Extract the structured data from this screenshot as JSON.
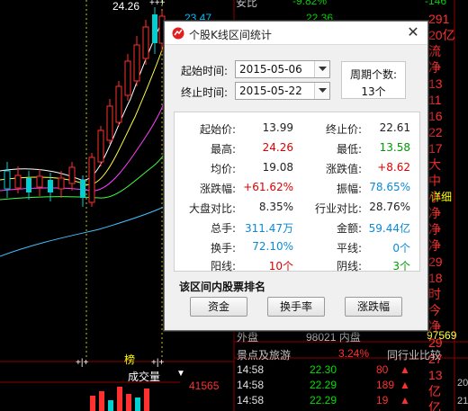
{
  "background": {
    "high_marker": "24.26",
    "cross_marks": "+++",
    "top_fragments": {
      "a": "安比",
      "b": "-9.82%",
      "c": "22.36",
      "d": "-146",
      "e": "23.47",
      "f": "流"
    },
    "right_column": [
      "291",
      "20亿",
      "流",
      "净",
      "13",
      "11",
      "16",
      "22",
      "17",
      "大",
      "中",
      "小",
      "净",
      "净",
      "净",
      "29",
      "18",
      "时",
      "今",
      "净",
      "29",
      "27",
      "13",
      "亿",
      "亿"
    ],
    "side_label": "详细",
    "side_value": "97569",
    "inner_fragment": "98021 内盘",
    "outer_label": "外盘",
    "board": {
      "bang": "榜",
      "arrows_left": "+|+",
      "arrows_right": "+|+",
      "volume_label": "成交量",
      "volume_value": "41565"
    },
    "quote_header": {
      "sector": "景点及旅游",
      "pct": "3.24%",
      "peer": "同行业比较"
    },
    "ticks": [
      {
        "time": "14:58",
        "price": "22.30",
        "vol": "80"
      },
      {
        "time": "14:58",
        "price": "22.29",
        "vol": "189"
      },
      {
        "time": "14:58",
        "price": "22.29",
        "vol": "19"
      }
    ],
    "right_tick_labels": [
      "20",
      "21"
    ]
  },
  "dialog": {
    "title": "个股K线区间统计",
    "start_label": "起始时间:",
    "start_value": "2015-05-06",
    "end_label": "终止时间:",
    "end_value": "2015-05-22",
    "period_label": "周期个数:",
    "period_value": "13个",
    "stats": {
      "start_price_label": "起始价:",
      "start_price": "13.99",
      "end_price_label": "终止价:",
      "end_price": "22.61",
      "high_label": "最高:",
      "high": "24.26",
      "low_label": "最低:",
      "low": "13.58",
      "avg_label": "均价:",
      "avg": "19.08",
      "change_label": "涨跌值:",
      "change": "+8.62",
      "change_pct_label": "涨跌幅:",
      "change_pct": "+61.62%",
      "amplitude_label": "振幅:",
      "amplitude": "78.65%",
      "market_label": "大盘对比:",
      "market": "8.35%",
      "industry_label": "行业对比:",
      "industry": "28.76%",
      "volume_label": "总手:",
      "volume": "311.47万",
      "amount_label": "金额:",
      "amount": "59.44亿",
      "turnover_label": "换手:",
      "turnover": "72.10%",
      "flat_label": "平线:",
      "flat": "0个",
      "up_label": "阳线:",
      "up": "10个",
      "down_label": "阴线:",
      "down": "3个"
    },
    "rank_title": "该区间内股票排名",
    "buttons": {
      "amount": "资金",
      "turnover": "换手率",
      "change": "涨跌幅"
    }
  },
  "colors": {
    "up": "#ff3030",
    "down": "#00d0d0",
    "ma_white": "#ffffff",
    "ma_yellow": "#ffff40",
    "ma_magenta": "#ff40ff",
    "ma_green": "#40ff40",
    "ma_cyan": "#40c0ff"
  }
}
